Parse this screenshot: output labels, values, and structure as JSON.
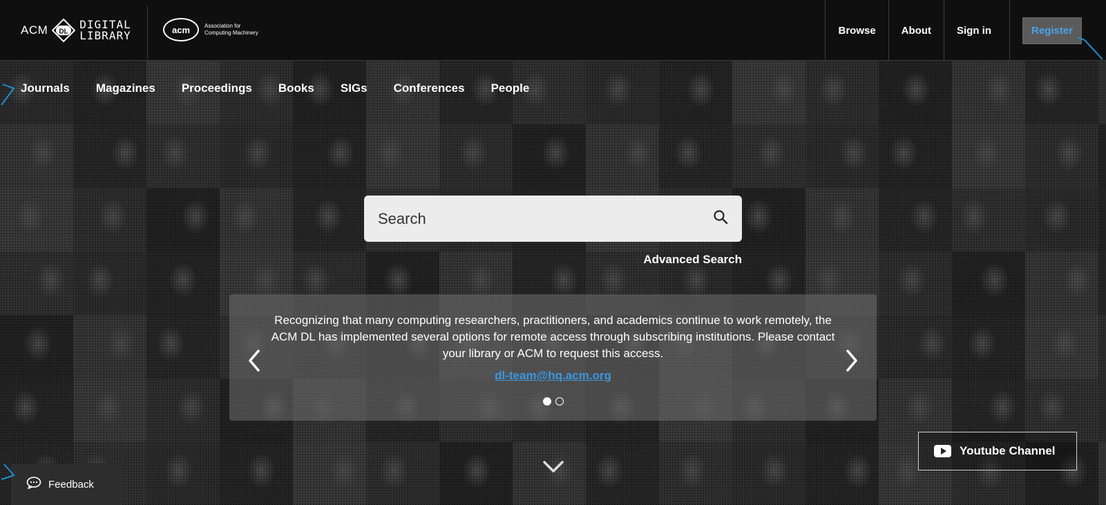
{
  "header": {
    "acm_dl_logo": {
      "acm": "ACM",
      "badge": "DL",
      "line1": "DIGITAL",
      "line2": "LIBRARY"
    },
    "acm_org_logo": {
      "mark": "acm",
      "line1": "Association for",
      "line2": "Computing Machinery"
    },
    "nav": {
      "browse": "Browse",
      "about": "About",
      "sign_in": "Sign in",
      "register": "Register"
    }
  },
  "subnav": [
    "Journals",
    "Magazines",
    "Proceedings",
    "Books",
    "SIGs",
    "Conferences",
    "People"
  ],
  "search": {
    "placeholder": "Search",
    "advanced": "Advanced Search"
  },
  "notice": {
    "message": "Recognizing that many computing researchers, practitioners, and academics continue to work remotely, the ACM DL has implemented several options for remote access through subscribing institutions. Please contact your library or ACM to request this access.",
    "email": "dl-team@hq.acm.org",
    "slides_total": 2,
    "slide_active": 1
  },
  "youtube": {
    "label": "Youtube Channel"
  },
  "feedback": {
    "label": "Feedback"
  },
  "colors": {
    "link": "#3b97e0",
    "register_text": "#4aa3e6",
    "annotation": "#1e90d6"
  },
  "icons": [
    "search-icon",
    "chevron-left-icon",
    "chevron-right-icon",
    "chevron-down-icon",
    "youtube-icon",
    "chat-bubble-icon"
  ]
}
